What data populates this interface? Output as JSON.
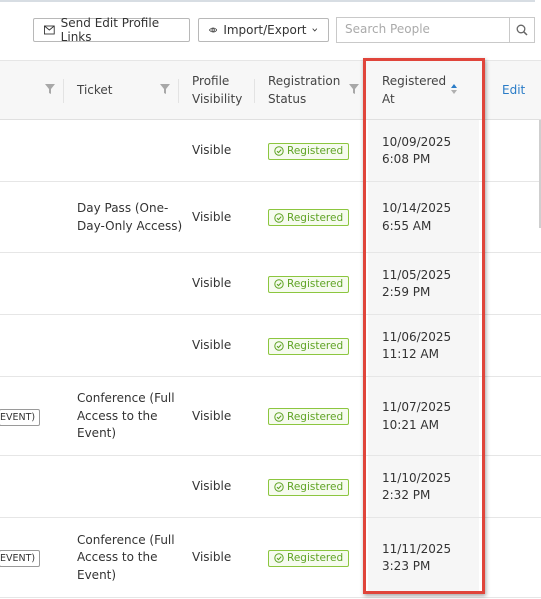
{
  "toolbar": {
    "send_edit_links": "Send Edit Profile Links",
    "import_export": "Import/Export",
    "search_placeholder": "Search People"
  },
  "table": {
    "headers": {
      "ticket": "Ticket",
      "profile_visibility_line1": "Profile",
      "profile_visibility_line2": "Visibility",
      "registration_status_line1": "Registration",
      "registration_status_line2": "Status",
      "registered_at_line1": "Registered",
      "registered_at_line2": "At",
      "edit": "Edit"
    },
    "rows": [
      {
        "chip": "",
        "ticket": [
          "",
          "",
          ""
        ],
        "visibility": "Visible",
        "status": "Registered",
        "date": "10/09/2025",
        "time": "6:08 PM"
      },
      {
        "chip": "",
        "ticket": [
          "Day Pass (One-",
          "Day-Only Access)",
          ""
        ],
        "visibility": "Visible",
        "status": "Registered",
        "date": "10/14/2025",
        "time": "6:55 AM"
      },
      {
        "chip": "",
        "ticket": [
          "",
          "",
          ""
        ],
        "visibility": "Visible",
        "status": "Registered",
        "date": "11/05/2025",
        "time": "2:59 PM"
      },
      {
        "chip": "",
        "ticket": [
          "",
          "",
          ""
        ],
        "visibility": "Visible",
        "status": "Registered",
        "date": "11/06/2025",
        "time": "11:12 AM"
      },
      {
        "chip": "EVENT)",
        "ticket": [
          "Conference (Full",
          "Access to the",
          "Event)"
        ],
        "visibility": "Visible",
        "status": "Registered",
        "date": "11/07/2025",
        "time": "10:21 AM"
      },
      {
        "chip": "",
        "ticket": [
          "",
          "",
          ""
        ],
        "visibility": "Visible",
        "status": "Registered",
        "date": "11/10/2025",
        "time": "2:32 PM"
      },
      {
        "chip": "EVENT)",
        "ticket": [
          "Conference (Full",
          "Access to the",
          "Event)"
        ],
        "visibility": "Visible",
        "status": "Registered",
        "date": "11/11/2025",
        "time": "3:23 PM"
      }
    ]
  },
  "colors": {
    "accent": "#2a7cc7",
    "registered": "#5fa324",
    "highlight": "#e0453b"
  },
  "icons": [
    "mail-icon",
    "eye-icon",
    "chevron-down-icon",
    "search-icon",
    "filter-icon",
    "sort-icon",
    "check-circle-icon"
  ]
}
